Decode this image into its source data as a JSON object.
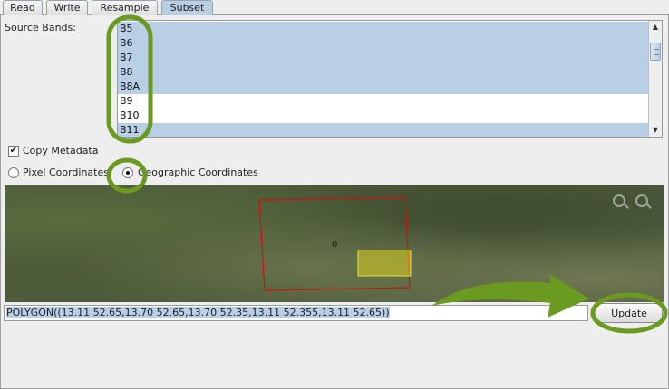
{
  "tabs": [
    {
      "label": "Read"
    },
    {
      "label": "Write"
    },
    {
      "label": "Resample"
    },
    {
      "label": "Subset"
    }
  ],
  "active_tab": "Subset",
  "source_bands": {
    "label": "Source Bands:",
    "items": [
      {
        "label": "B5",
        "selected": true
      },
      {
        "label": "B6",
        "selected": true
      },
      {
        "label": "B7",
        "selected": true
      },
      {
        "label": "B8",
        "selected": true
      },
      {
        "label": "B8A",
        "selected": true
      },
      {
        "label": "B9",
        "selected": false
      },
      {
        "label": "B10",
        "selected": false
      },
      {
        "label": "B11",
        "selected": true
      }
    ]
  },
  "copy_metadata": {
    "label": "Copy Metadata",
    "checked": true,
    "mark": "✔"
  },
  "coordinates": {
    "pixel_label": "Pixel Coordinates",
    "geographic_label": "Geographic Coordinates",
    "selected": "geographic"
  },
  "map": {
    "marker_text": "0",
    "icons": [
      "zoom-in-icon",
      "zoom-out-icon"
    ]
  },
  "wkt_value": "POLYGON((13.11 52.65,13.70 52.65,13.70 52.35,13.11 52.355,13.11 52.65))",
  "update_label": "Update",
  "colors": {
    "selection": "#b8cfe5",
    "annotation": "#6a9a1f",
    "polygon_outline": "#d01010",
    "highlight_fill": "#d8d020"
  }
}
